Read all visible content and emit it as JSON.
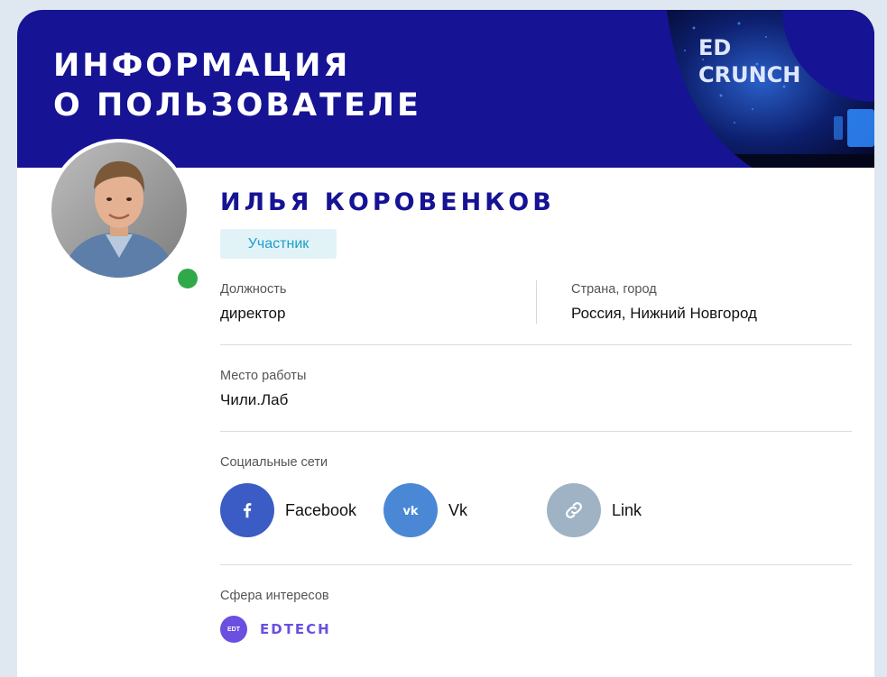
{
  "banner": {
    "title_line1": "ИНФОРМАЦИЯ",
    "title_line2": "О ПОЛЬЗОВАТЕЛЕ",
    "logo_line1": "ED",
    "logo_line2": "CRUNCH"
  },
  "profile": {
    "name": "ИЛЬЯ КОРОВЕНКОВ",
    "role": "Участник",
    "online": true
  },
  "fields": {
    "position_label": "Должность",
    "position_value": "директор",
    "location_label": "Страна, город",
    "location_value": "Россия, Нижний Новгород",
    "workplace_label": "Место работы",
    "workplace_value": "Чили.Лаб"
  },
  "social": {
    "label": "Социальные сети",
    "links": [
      {
        "name": "Facebook",
        "icon": "facebook-icon",
        "color": "#3b5cc5"
      },
      {
        "name": "Vk",
        "icon": "vk-icon",
        "color": "#4a88d6"
      },
      {
        "name": "Link",
        "icon": "link-icon",
        "color": "#9fb3c5"
      }
    ]
  },
  "interests": {
    "label": "Сфера интересов",
    "items": [
      {
        "badge": "EDT",
        "name": "EDTECH",
        "color": "#6a4fe0"
      }
    ]
  },
  "colors": {
    "banner": "#161394",
    "accent": "#161394",
    "online": "#31a84a",
    "role_bg": "#e2f3f8",
    "role_text": "#1a9fc9"
  }
}
